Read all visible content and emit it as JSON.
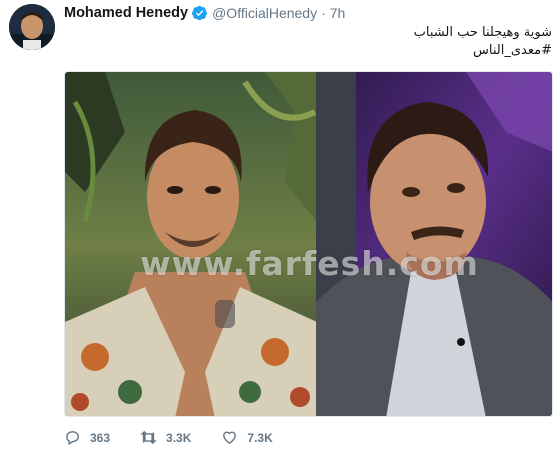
{
  "tweet": {
    "author_name": "Mohamed Henedy",
    "handle": "@OfficialHenedy",
    "separator": "·",
    "time": "7h",
    "text_line_1": "شوية وهيجلنا حب الشباب",
    "text_line_2": "#معدى_الناس",
    "watermark": "www.farfesh.com",
    "icons": {
      "verified": "verified-badge-icon",
      "reply": "reply-icon",
      "retweet": "retweet-icon",
      "like": "heart-icon"
    },
    "colors": {
      "verified": "#1da1f2",
      "secondary_text": "#657786"
    }
  },
  "actions": {
    "replies": "363",
    "retweets": "3.3K",
    "likes": "7.3K"
  }
}
